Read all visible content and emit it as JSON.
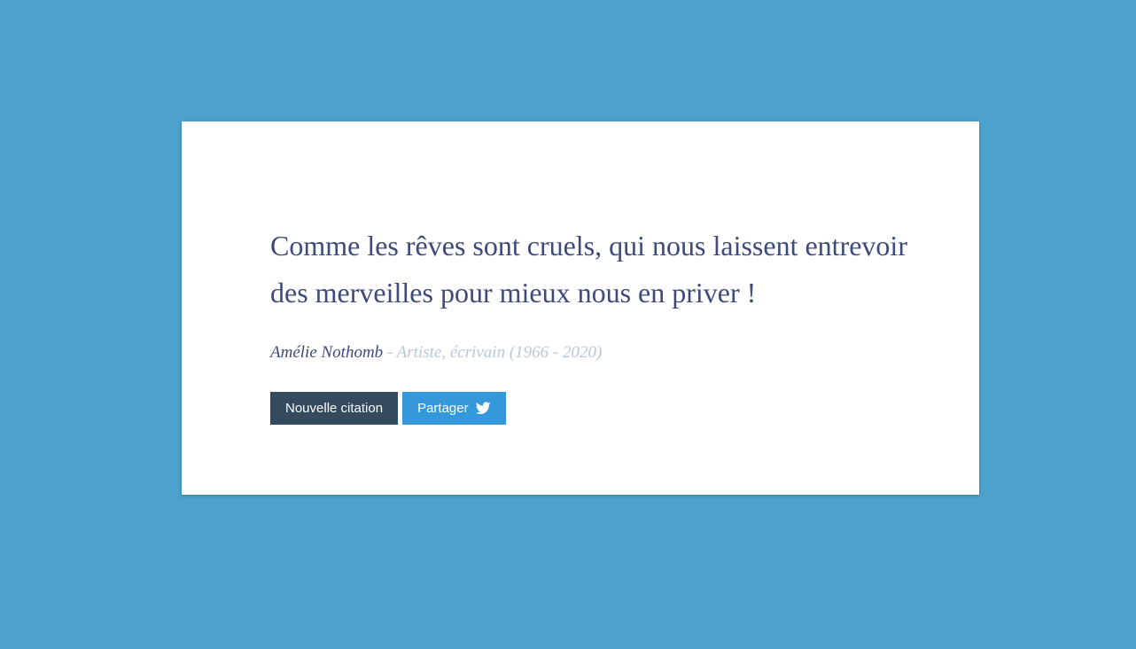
{
  "quote": {
    "text": "Comme les rêves sont cruels, qui nous laissent entrevoir des merveilles pour mieux nous en priver !",
    "author": "Amélie Nothomb",
    "details": " - Artiste, écrivain (1966 - 2020)"
  },
  "buttons": {
    "new_quote_label": "Nouvelle citation",
    "share_label": "Partager",
    "share_icon": "twitter-icon"
  },
  "colors": {
    "background": "#4ca1cd",
    "card": "#ffffff",
    "quote_text": "#3d4a7a",
    "details_text": "#b7c8d8",
    "new_quote_button": "#344a5e",
    "share_button": "#3498db"
  }
}
